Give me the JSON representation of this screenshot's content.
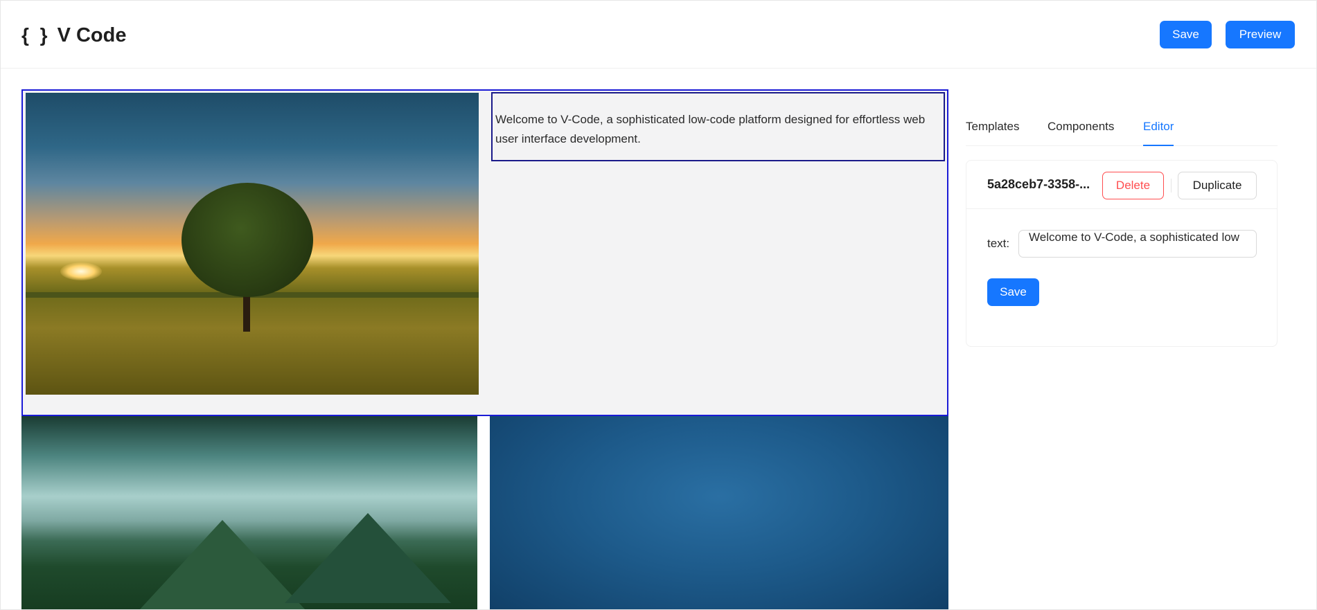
{
  "app": {
    "logo_icon": "{ }",
    "title": "V Code"
  },
  "header": {
    "save_label": "Save",
    "preview_label": "Preview"
  },
  "canvas": {
    "text_block": "Welcome to V-Code, a sophisticated low-code platform designed for effortless web user interface development."
  },
  "panel": {
    "tabs": [
      {
        "label": "Templates"
      },
      {
        "label": "Components"
      },
      {
        "label": "Editor"
      }
    ],
    "active_tab": "Editor",
    "editor": {
      "component_id": "5a28ceb7-3358-...",
      "delete_label": "Delete",
      "duplicate_label": "Duplicate",
      "field_label": "text:",
      "field_value": "Welcome to V-Code, a sophisticated low",
      "save_label": "Save"
    }
  },
  "colors": {
    "primary": "#1677ff",
    "danger": "#ff4d4f",
    "selection_border": "#1a1ad6"
  }
}
